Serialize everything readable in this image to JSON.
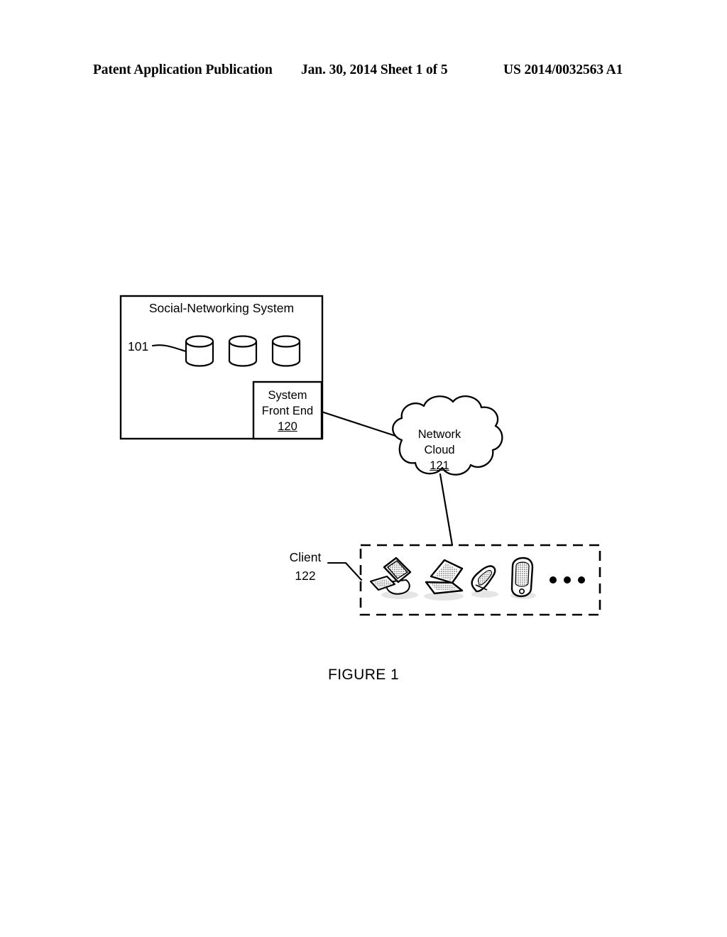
{
  "page": {
    "background_color": "#ffffff",
    "ink_color": "#000000"
  },
  "header": {
    "left": "Patent Application Publication",
    "middle": "Jan. 30, 2014  Sheet 1 of 5",
    "right": "US 2014/0032563 A1"
  },
  "figure": {
    "caption": "FIGURE 1",
    "social_networking_system": {
      "title": "Social-Networking System",
      "reference_numeral": "101",
      "database_count": 3,
      "front_end": {
        "line1": "System",
        "line2": "Front End",
        "reference_numeral": "120"
      }
    },
    "network_cloud": {
      "line1": "Network",
      "line2": "Cloud",
      "reference_numeral": "121"
    },
    "client": {
      "label": "Client",
      "reference_numeral": "122",
      "devices": [
        "desktop-computer-icon",
        "laptop-icon",
        "flip-phone-icon",
        "pda-smartphone-icon"
      ],
      "ellipsis": "• • •"
    }
  }
}
